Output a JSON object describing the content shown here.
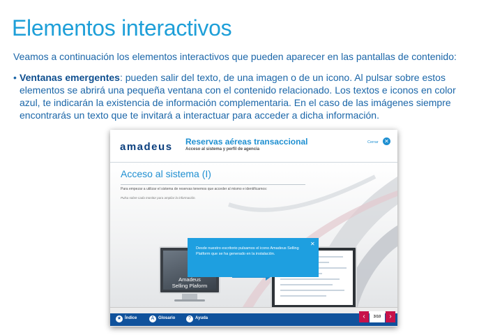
{
  "page": {
    "title": "Elementos interactivos",
    "intro": "Veamos a continuación los elementos interactivos que pueden aparecer en las pantallas de contenido:",
    "bullet_marker": "•",
    "bullet_term": "Ventanas emergentes",
    "bullet_text": ": pueden salir del texto, de una imagen o de un icono. Al pulsar sobre estos elementos se abrirá una pequeña ventana con el contenido relacionado. Los textos e iconos en color azul, te indicarán la existencia de información complementaria. En el caso de las imágenes siempre encontrarás un texto que te invitará a interactuar para acceder a dicha información."
  },
  "screenshot": {
    "logo": "amadeus",
    "course_title": "Reservas aéreas transaccional",
    "course_subtitle": "Acceso al sistema y perfil de agencia",
    "close_label": "Cerrar",
    "close_icon_glyph": "✕",
    "section_title": "Acceso al sistema (I)",
    "section_text": "Para empezar a utilizar el sistema de reservas tenemos que acceder al mismo e identificarnos:",
    "section_hint": "Pulsa sobre cada monitor para ampliar la información.",
    "monitor_label": "Amadeus\nSelling Plaform",
    "popup_text": "Desde nuestro escritorio pulsamos el icono Amadeus Selling Platform que se ha generado en la instalación.",
    "popup_close": "✕",
    "footer": {
      "index": "Índice",
      "glossary": "Glosario",
      "help": "Ayuda",
      "page": "3/10",
      "prev": "‹",
      "next": "›"
    },
    "colors": {
      "accent": "#1e9fe0",
      "footer_bar": "#10529c",
      "nav_buttons": "#c7124a"
    }
  }
}
